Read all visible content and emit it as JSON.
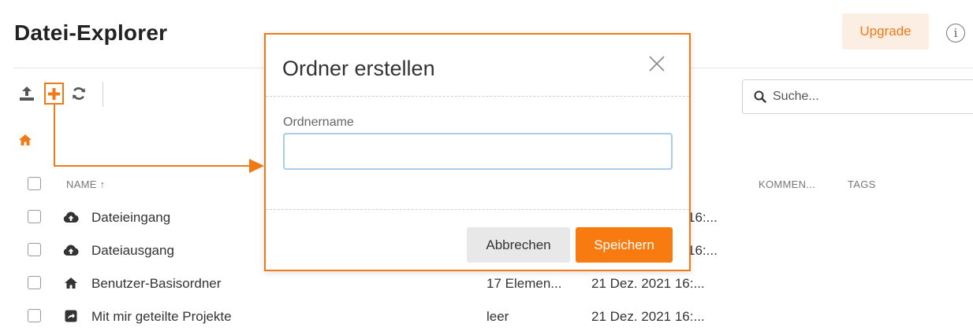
{
  "header": {
    "title": "Datei-Explorer",
    "upgrade_label": "Upgrade",
    "info_icon": "info-icon"
  },
  "toolbar": {
    "icons": [
      "upload-icon",
      "add-folder-icon",
      "refresh-icon"
    ],
    "accent_color": "#f07a17"
  },
  "search": {
    "placeholder": "Suche..."
  },
  "breadcrumb": {
    "icon": "home-icon"
  },
  "table": {
    "columns": {
      "name": "NAME ↑",
      "comments": "KOMMEN...",
      "tags": "TAGS"
    },
    "rows": [
      {
        "icon": "cloud-upload-icon",
        "name": "Dateieingang",
        "size": "",
        "date": "16:..."
      },
      {
        "icon": "cloud-upload-icon",
        "name": "Dateiausgang",
        "size": "",
        "date": "16:..."
      },
      {
        "icon": "home-icon",
        "name": "Benutzer-Basisordner",
        "size": "17 Elemen...",
        "date": "21 Dez. 2021 16:..."
      },
      {
        "icon": "shared-folder-icon",
        "name": "Mit mir geteilte Projekte",
        "size": "leer",
        "date": "21 Dez. 2021 16:..."
      }
    ]
  },
  "dialog": {
    "title": "Ordner erstellen",
    "field_label": "Ordnername",
    "field_value": "",
    "cancel_label": "Abbrechen",
    "save_label": "Speichern"
  }
}
